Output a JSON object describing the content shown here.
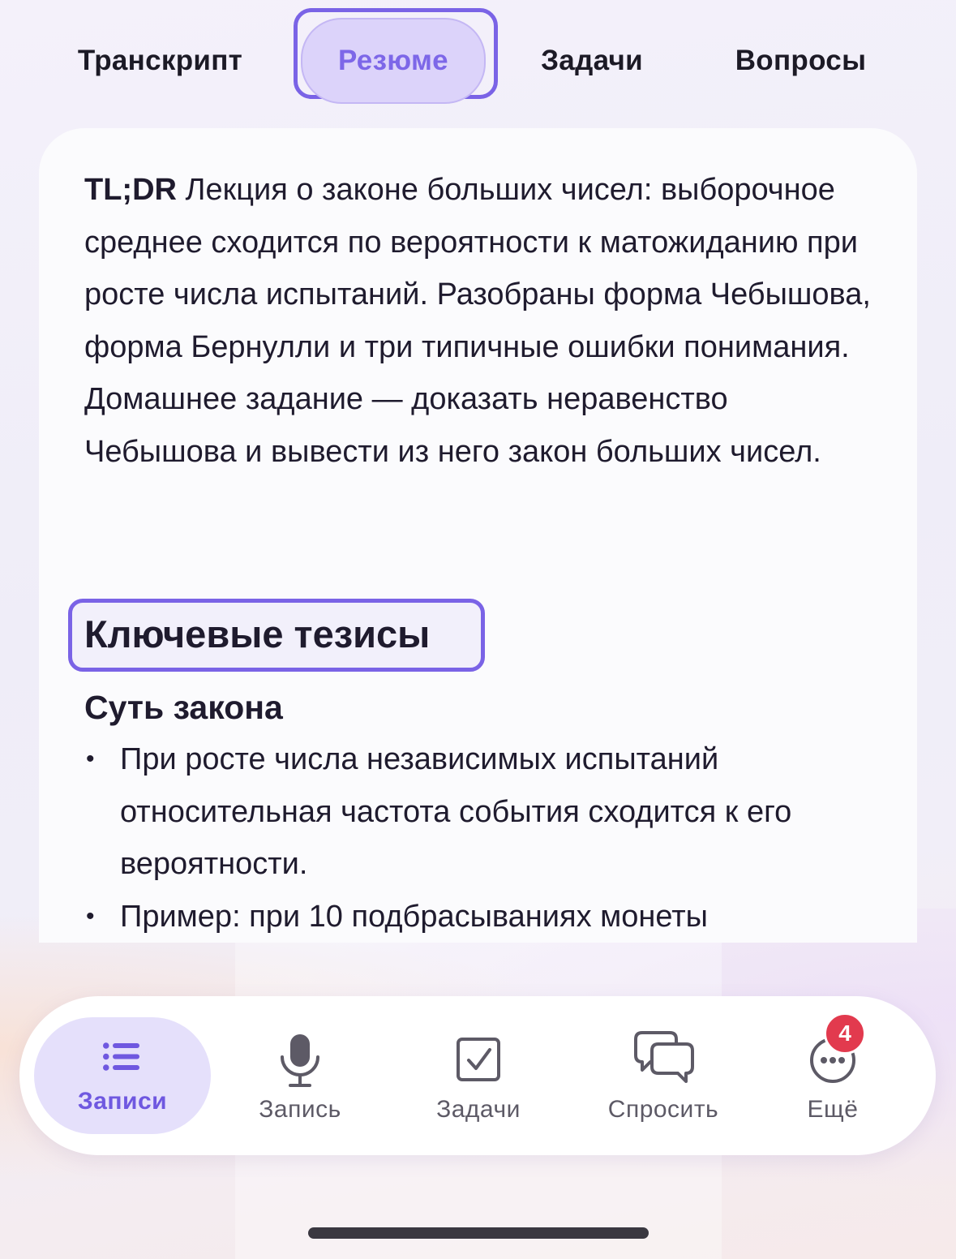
{
  "tabs": [
    {
      "label": "Транскрипт",
      "active": false
    },
    {
      "label": "Резюме",
      "active": true
    },
    {
      "label": "Задачи",
      "active": false
    },
    {
      "label": "Вопросы",
      "active": false
    }
  ],
  "summary": {
    "tldr_label": "TL;DR",
    "text": "Лекция о законе больших чисел: выборочное среднее сходится по вероятности к матожиданию при росте числа испытаний. Разобраны форма Чебышова, форма Бернулли и три типичные ошибки понимания. Домашнее задание — доказать неравенство Чебышова и вывести из него закон больших чисел."
  },
  "key_points": {
    "title": "Ключевые тезисы",
    "sections": [
      {
        "title": "Суть закона",
        "bullets": [
          "При росте числа независимых испытаний относительная частота события сходится к его вероятности.",
          "Пример: при 10 подбрасываниях монеты"
        ]
      }
    ]
  },
  "bottom_nav": {
    "items": [
      {
        "label": "Записи",
        "icon": "list-icon",
        "active": true
      },
      {
        "label": "Запись",
        "icon": "microphone-icon",
        "active": false
      },
      {
        "label": "Задачи",
        "icon": "checkbox-icon",
        "active": false
      },
      {
        "label": "Спросить",
        "icon": "chat-bubbles-icon",
        "active": false
      },
      {
        "label": "Ещё",
        "icon": "more-icon",
        "active": false
      }
    ],
    "more_badge": "4"
  },
  "colors": {
    "accent": "#7a63e6",
    "accent_light": "#dcd3fa",
    "badge": "#e23a4e",
    "text": "#1f1b2e"
  }
}
